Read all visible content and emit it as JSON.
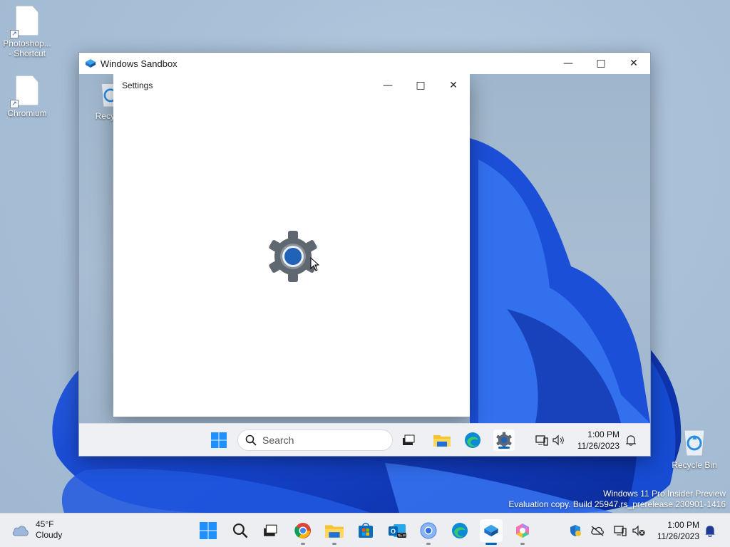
{
  "desktop": {
    "icons": [
      {
        "label": "Photoshop...\n- Shortcut"
      },
      {
        "label": "Chromium"
      }
    ],
    "recycle_bin_label": "Recycle Bin"
  },
  "sandbox": {
    "title": "Windows Sandbox",
    "inner_recycle_label": "Recycle",
    "settings": {
      "title": "Settings"
    },
    "taskbar": {
      "search_placeholder": "Search",
      "time": "1:00 PM",
      "date": "11/26/2023"
    }
  },
  "taskbar": {
    "weather_temp": "45°F",
    "weather_cond": "Cloudy",
    "time": "1:00 PM",
    "date": "11/26/2023"
  },
  "watermark": {
    "line1": "Windows 11 Pro Insider Preview",
    "line2": "Evaluation copy. Build 25947.rs_prerelease.230901-1416"
  },
  "colors": {
    "accent": "#0067c0",
    "bloom": "#1a4fd6"
  }
}
